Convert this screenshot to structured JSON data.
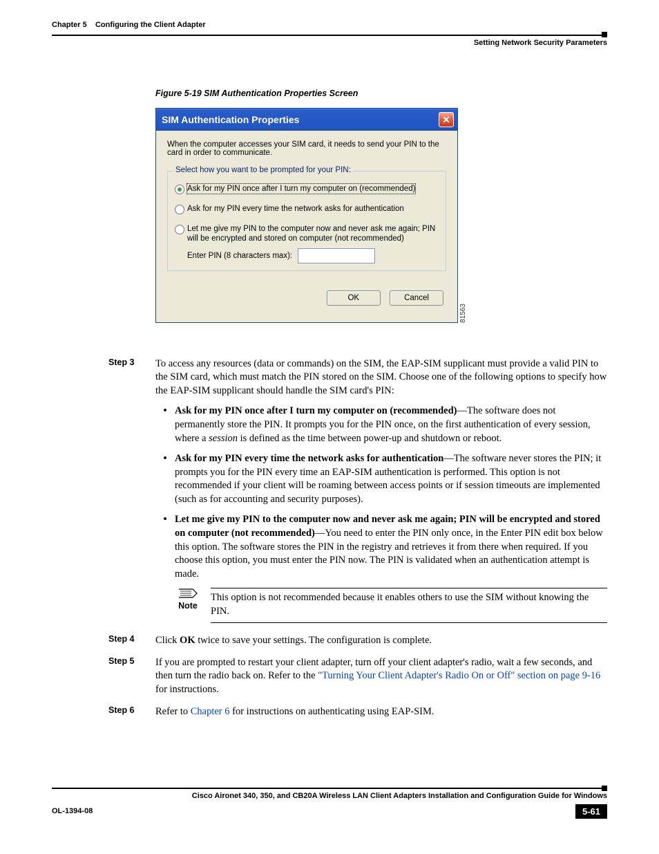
{
  "header": {
    "chapter_label": "Chapter 5",
    "chapter_title": "Configuring the Client Adapter",
    "section_title": "Setting Network Security Parameters"
  },
  "figure_caption": "Figure 5-19   SIM Authentication Properties Screen",
  "dialog": {
    "title": "SIM Authentication Properties",
    "intro": "When the computer accesses your SIM card, it needs to send your PIN to the card in order to communicate.",
    "group_legend": "Select how you want to be prompted for your PIN:",
    "radio1": "Ask for my PIN once after I turn my computer on (recommended)",
    "radio2": "Ask for my PIN every time the network asks for authentication",
    "radio3": "Let me give my PIN to the computer now and never ask me again; PIN will be encrypted and stored on computer (not recommended)",
    "pin_label": "Enter PIN (8 characters max):",
    "ok": "OK",
    "cancel": "Cancel",
    "image_id": "81563"
  },
  "steps": {
    "s3": {
      "label": "Step 3",
      "intro": "To access any resources (data or commands) on the SIM, the EAP-SIM supplicant must provide a valid PIN to the SIM card, which must match the PIN stored on the SIM. Choose one of the following options to specify how the EAP-SIM supplicant should handle the SIM card's PIN:",
      "b1_bold": "Ask for my PIN once after I turn my computer on (recommended)",
      "b1_rest_a": "—The software does not permanently store the PIN. It prompts you for the PIN once, on the first authentication of every session, where a ",
      "b1_session": "session",
      "b1_rest_b": " is defined as the time between power-up and shutdown or reboot.",
      "b2_bold": "Ask for my PIN every time the network asks for authentication",
      "b2_rest": "—The software never stores the PIN; it prompts you for the PIN every time an EAP-SIM authentication is performed. This option is not recommended if your client will be roaming between access points or if session timeouts are implemented (such as for accounting and security purposes).",
      "b3_bold": "Let me give my PIN to the computer now and never ask me again; PIN will be encrypted and stored on computer (not recommended)",
      "b3_rest": "—You need to enter the PIN only once, in the Enter PIN edit box below this option. The software stores the PIN in the registry and retrieves it from there when required. If you choose this option, you must enter the PIN now. The PIN is validated when an authentication attempt is made.",
      "note_label": "Note",
      "note_text": "This option is not recommended because it enables others to use the SIM without knowing the PIN."
    },
    "s4": {
      "label": "Step 4",
      "text_a": "Click ",
      "ok": "OK",
      "text_b": " twice to save your settings. The configuration is complete."
    },
    "s5": {
      "label": "Step 5",
      "text_a": "If you are prompted to restart your client adapter, turn off your client adapter's radio, wait a few seconds, and then turn the radio back on. Refer to the ",
      "link": "\"Turning Your Client Adapter's Radio On or Off\" section on page 9-16",
      "text_b": " for instructions."
    },
    "s6": {
      "label": "Step 6",
      "text_a": "Refer to ",
      "link": "Chapter 6",
      "text_b": " for instructions on authenticating using EAP-SIM."
    }
  },
  "footer": {
    "guide_title": "Cisco Aironet 340, 350, and CB20A Wireless LAN Client Adapters Installation and Configuration Guide for Windows",
    "doc_id": "OL-1394-08",
    "page_num": "5-61"
  }
}
